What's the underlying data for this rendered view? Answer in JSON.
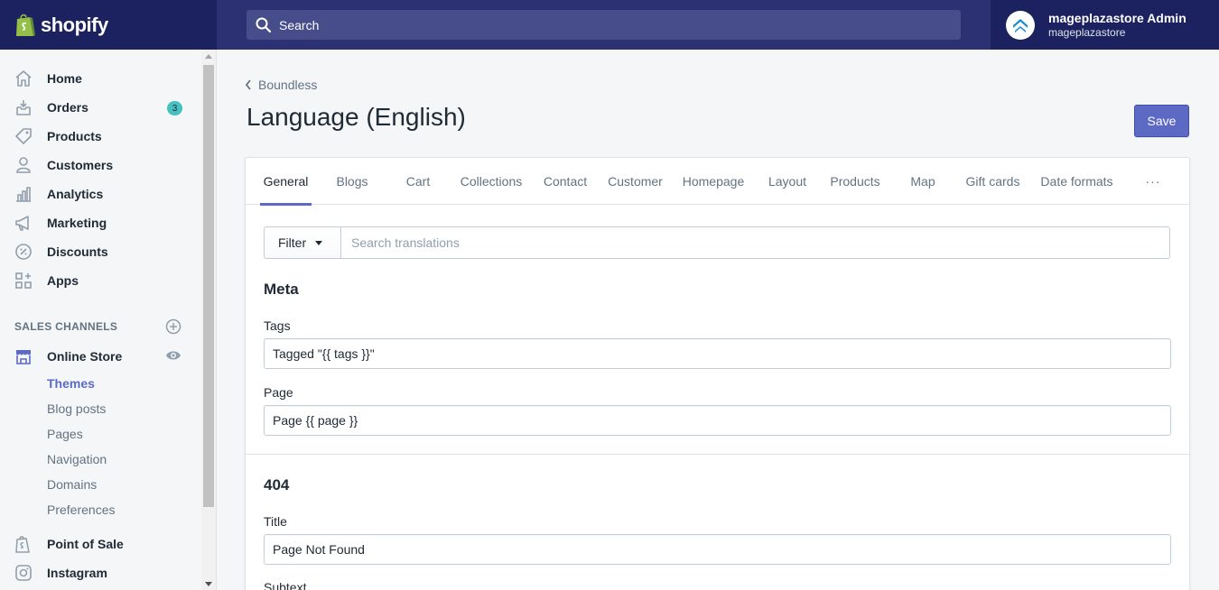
{
  "brand": {
    "name": "shopify"
  },
  "search": {
    "placeholder": "Search"
  },
  "account": {
    "name": "mageplazastore Admin",
    "store": "mageplazastore"
  },
  "sidebar": {
    "items": [
      {
        "label": "Home",
        "icon": "home-icon"
      },
      {
        "label": "Orders",
        "icon": "orders-icon",
        "badge": "3"
      },
      {
        "label": "Products",
        "icon": "tag-icon"
      },
      {
        "label": "Customers",
        "icon": "person-icon"
      },
      {
        "label": "Analytics",
        "icon": "bar-chart-icon"
      },
      {
        "label": "Marketing",
        "icon": "megaphone-icon"
      },
      {
        "label": "Discounts",
        "icon": "discount-icon"
      },
      {
        "label": "Apps",
        "icon": "apps-icon"
      }
    ],
    "sales_channels_heading": "SALES CHANNELS",
    "online_store": {
      "label": "Online Store",
      "icon": "store-icon"
    },
    "online_store_subitems": [
      "Themes",
      "Blog posts",
      "Pages",
      "Navigation",
      "Domains",
      "Preferences"
    ],
    "active_subitem": "Themes",
    "other_channels": [
      {
        "label": "Point of Sale",
        "icon": "shopify-bag-icon"
      },
      {
        "label": "Instagram",
        "icon": "instagram-icon"
      }
    ]
  },
  "breadcrumb": {
    "label": "Boundless"
  },
  "page": {
    "title": "Language (English)",
    "save_label": "Save"
  },
  "tabs": [
    "General",
    "Blogs",
    "Cart",
    "Collections",
    "Contact",
    "Customer",
    "Homepage",
    "Layout",
    "Products",
    "Map",
    "Gift cards",
    "Date formats"
  ],
  "active_tab": "General",
  "more_tabs_label": "···",
  "filter": {
    "label": "Filter",
    "search_placeholder": "Search translations"
  },
  "sections": [
    {
      "title": "Meta",
      "fields": [
        {
          "label": "Tags",
          "value": "Tagged \"{{ tags }}\""
        },
        {
          "label": "Page",
          "value": "Page {{ page }}"
        }
      ]
    },
    {
      "title": "404",
      "fields": [
        {
          "label": "Title",
          "value": "Page Not Found"
        },
        {
          "label": "Subtext",
          "value": ""
        }
      ]
    }
  ],
  "colors": {
    "topbar": "#1c2260",
    "search_bg": "#464d8a",
    "accent": "#5c6ac4",
    "badge": "#47c1bf"
  }
}
